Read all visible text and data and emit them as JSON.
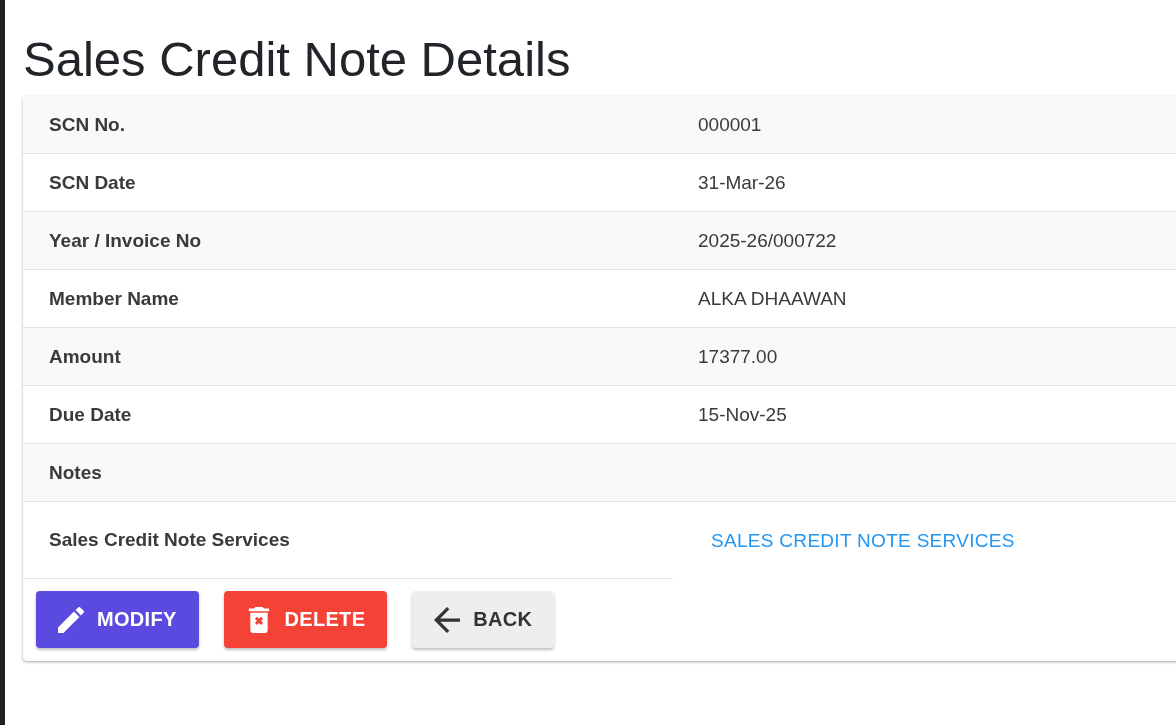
{
  "title": "Sales Credit Note Details",
  "details": [
    {
      "kind": "text",
      "label": "SCN No.",
      "value": "000001"
    },
    {
      "kind": "text",
      "label": "SCN Date",
      "value": "31-Mar-26"
    },
    {
      "kind": "text",
      "label": "Year / Invoice No",
      "value": "2025-26/000722"
    },
    {
      "kind": "text",
      "label": "Member Name",
      "value": "ALKA DHAAWAN"
    },
    {
      "kind": "text",
      "label": "Amount",
      "value": "17377.00"
    },
    {
      "kind": "text",
      "label": "Due Date",
      "value": "15-Nov-25"
    },
    {
      "kind": "text",
      "label": "Notes"
    },
    {
      "kind": "link",
      "label": "Sales Credit Note Services",
      "value": "SALES CREDIT NOTE SERVICES"
    }
  ],
  "buttons": [
    {
      "kind": "modify",
      "label": "MODIFY"
    },
    {
      "kind": "delete",
      "label": "DELETE"
    },
    {
      "kind": "back",
      "label": "BACK"
    }
  ]
}
